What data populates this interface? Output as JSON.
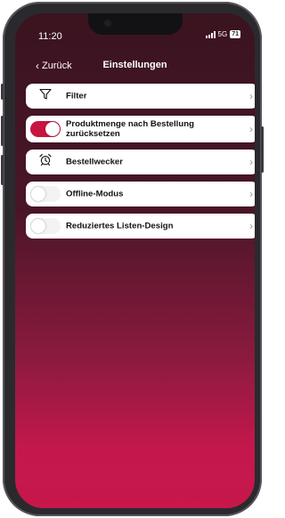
{
  "status_bar": {
    "time": "11:20",
    "network": "5G",
    "battery": "71"
  },
  "nav": {
    "back_label": "Zurück",
    "back_icon": "chevron-left-icon",
    "title": "Einstellungen"
  },
  "settings": [
    {
      "label": "Filter",
      "control": "filter-icon"
    },
    {
      "label": "Produktmenge nach Bestellung zurücksetzen",
      "control": "toggle",
      "state": "on"
    },
    {
      "label": "Bestellwecker",
      "control": "alarm-clock-icon"
    },
    {
      "label": "Offline-Modus",
      "control": "toggle",
      "state": "off"
    },
    {
      "label": "Reduziertes Listen-Design",
      "control": "toggle",
      "state": "off"
    }
  ],
  "row_chevron": "›",
  "colors": {
    "accent": "#c8153f",
    "gradient_top": "#3a1420",
    "gradient_bottom": "#c7174b"
  }
}
